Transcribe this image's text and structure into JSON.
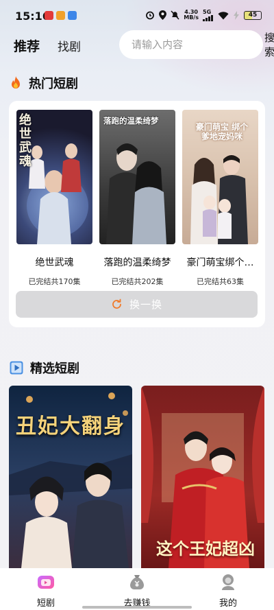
{
  "status_bar": {
    "time": "15:16",
    "net_speed_value": "4.30",
    "net_speed_unit": "MB/s",
    "network": "5G",
    "battery": "45"
  },
  "header": {
    "tabs": [
      {
        "label": "推荐",
        "active": true
      },
      {
        "label": "找剧",
        "active": false
      }
    ],
    "search": {
      "placeholder": "请输入内容",
      "button": "搜索"
    }
  },
  "hot": {
    "title": "热门短剧",
    "title_icon": "fire-icon",
    "items": [
      {
        "name": "绝世武魂",
        "meta": "已完结共170集",
        "poster_text": "绝世武魂"
      },
      {
        "name": "落跑的温柔绮梦",
        "meta": "已完结共202集",
        "poster_text": "落跑的温柔绮梦"
      },
      {
        "name": "豪门萌宝绑个…",
        "meta": "已完结共63集",
        "poster_text": "豪门萌宝 绑个爹地宠妈咪"
      }
    ],
    "refresh_label": "换一换"
  },
  "featured": {
    "title": "精选短剧",
    "title_icon": "play-square-icon",
    "items": [
      {
        "poster_text": "丑妃大翻身"
      },
      {
        "poster_text": "这个王妃超凶"
      }
    ]
  },
  "bottom_nav": [
    {
      "label": "短剧",
      "icon": "tv-icon",
      "active": true
    },
    {
      "label": "去赚钱",
      "icon": "money-bag-icon",
      "active": false
    },
    {
      "label": "我的",
      "icon": "profile-icon",
      "active": false
    }
  ],
  "colors": {
    "accent_orange": "#f07a2a",
    "refresh_bg": "#d9d9db"
  }
}
